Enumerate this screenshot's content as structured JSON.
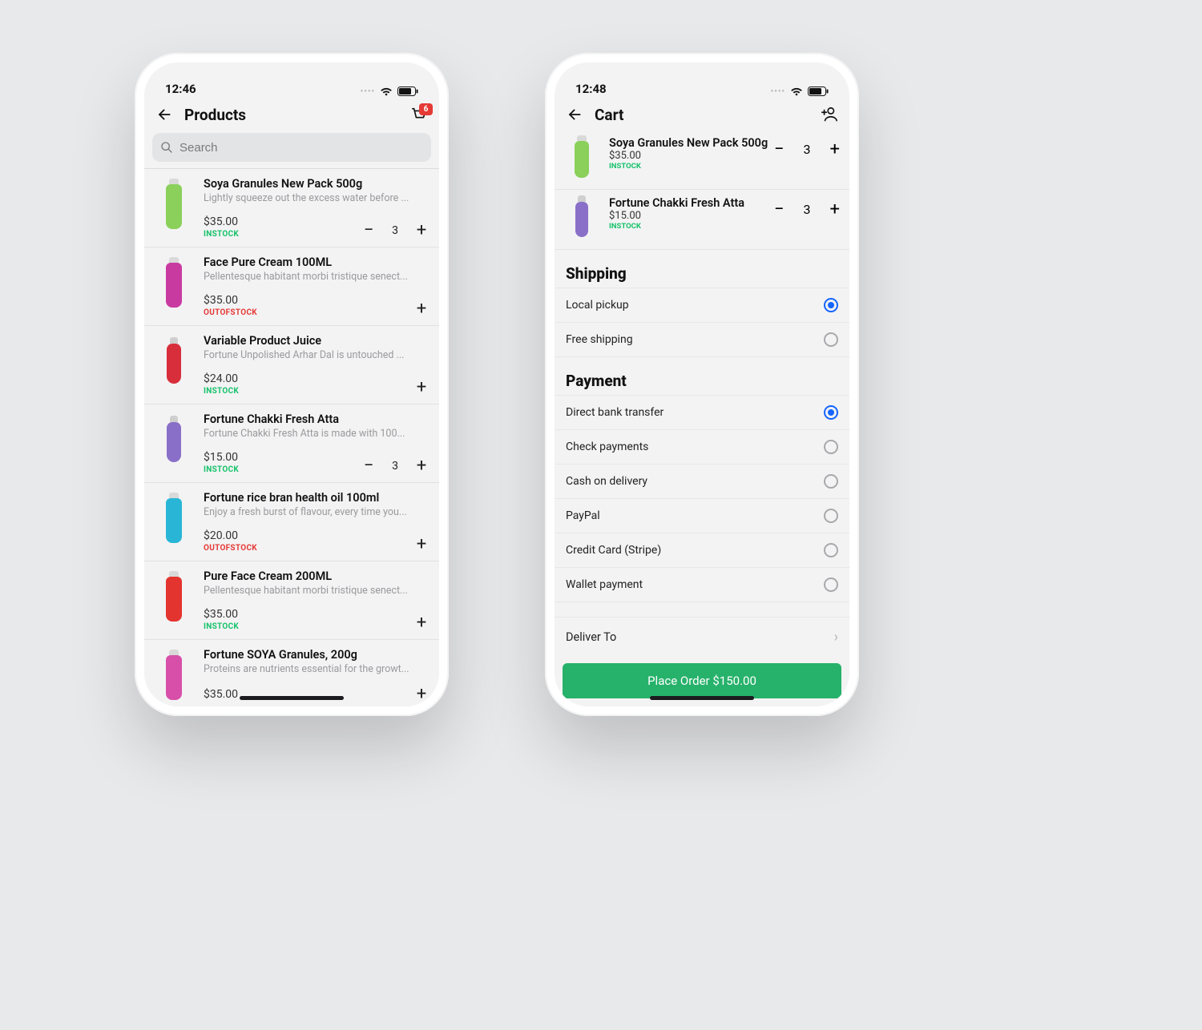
{
  "left": {
    "status_time": "12:46",
    "nav_title": "Products",
    "cart_badge": "6",
    "search_placeholder": "Search",
    "products": [
      {
        "name": "Soya Granules New Pack 500g",
        "desc": "Lightly squeeze out the excess water before ...",
        "price": "$35.00",
        "stock": "INSTOCK",
        "stock_state": "in",
        "qty": "3",
        "has_qty": true,
        "thumb": "tube",
        "color": "#8ad05b"
      },
      {
        "name": "Face Pure Cream 100ML",
        "desc": "Pellentesque habitant morbi tristique senect...",
        "price": "$35.00",
        "stock": "OUTOFSTOCK",
        "stock_state": "out",
        "has_qty": false,
        "thumb": "tube",
        "color": "#c93aa1"
      },
      {
        "name": "Variable Product Juice",
        "desc": "Fortune Unpolished Arhar Dal is untouched ...",
        "price": "$24.00",
        "stock": "INSTOCK",
        "stock_state": "in",
        "has_qty": false,
        "thumb": "bottle",
        "color": "#d82e3b"
      },
      {
        "name": "Fortune Chakki Fresh Atta",
        "desc": "Fortune Chakki Fresh Atta is made with 100...",
        "price": "$15.00",
        "stock": "INSTOCK",
        "stock_state": "in",
        "qty": "3",
        "has_qty": true,
        "thumb": "bottle",
        "color": "#8a6fc8"
      },
      {
        "name": "Fortune rice bran health oil 100ml",
        "desc": "Enjoy a fresh burst of flavour, every time you...",
        "price": "$20.00",
        "stock": "OUTOFSTOCK",
        "stock_state": "out",
        "has_qty": false,
        "thumb": "tube",
        "color": "#29b6d6"
      },
      {
        "name": "Pure Face Cream 200ML",
        "desc": "Pellentesque habitant morbi tristique senect...",
        "price": "$35.00",
        "stock": "INSTOCK",
        "stock_state": "in",
        "has_qty": false,
        "thumb": "tube",
        "color": "#e3342f"
      },
      {
        "name": "Fortune SOYA Granules, 200g",
        "desc": "Proteins are nutrients essential for the growt...",
        "price": "$35.00",
        "stock": "",
        "has_qty": false,
        "thumb": "tube",
        "color": "#d84fa9",
        "cut": true
      }
    ]
  },
  "right": {
    "status_time": "12:48",
    "nav_title": "Cart",
    "items": [
      {
        "name": "Soya Granules New Pack 500g",
        "price": "$35.00",
        "stock": "INSTOCK",
        "qty": "3",
        "thumb": "tube",
        "color": "#8ad05b"
      },
      {
        "name": "Fortune Chakki Fresh Atta",
        "price": "$15.00",
        "stock": "INSTOCK",
        "qty": "3",
        "thumb": "bottle",
        "color": "#8a6fc8"
      }
    ],
    "shipping_title": "Shipping",
    "shipping_options": [
      {
        "label": "Local pickup",
        "selected": true
      },
      {
        "label": "Free shipping",
        "selected": false
      }
    ],
    "payment_title": "Payment",
    "payment_options": [
      {
        "label": "Direct bank transfer",
        "selected": true
      },
      {
        "label": "Check payments",
        "selected": false
      },
      {
        "label": "Cash on delivery",
        "selected": false
      },
      {
        "label": "PayPal",
        "selected": false
      },
      {
        "label": "Credit Card (Stripe)",
        "selected": false
      },
      {
        "label": "Wallet payment",
        "selected": false
      }
    ],
    "deliver_label": "Deliver To",
    "place_order": "Place Order $150.00"
  }
}
